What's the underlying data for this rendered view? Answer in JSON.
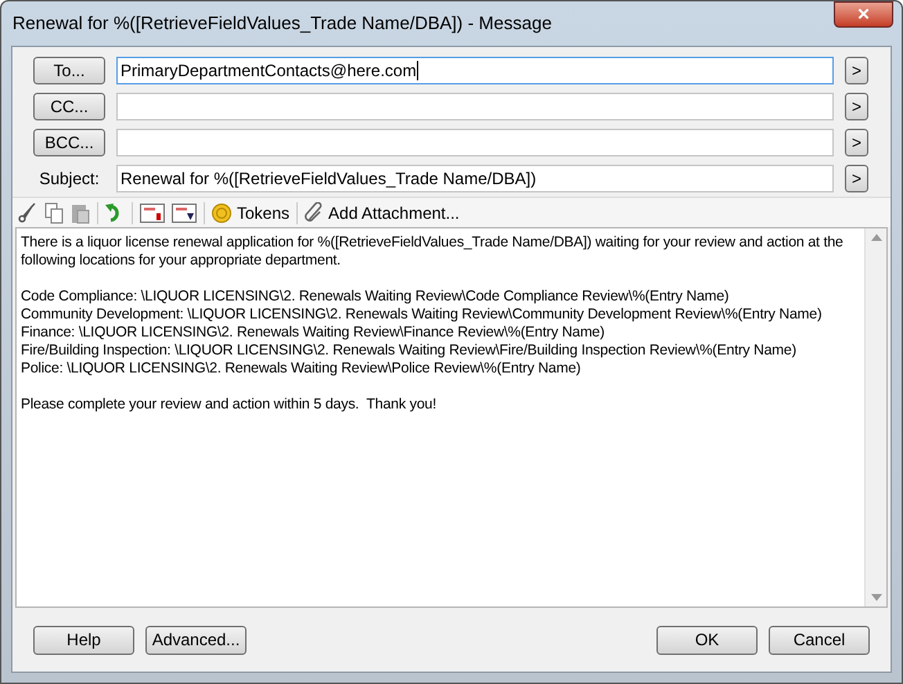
{
  "window": {
    "title": "Renewal for %([RetrieveFieldValues_Trade Name/DBA]) - Message",
    "close": "×"
  },
  "recipients": [
    {
      "kind": "button",
      "label": "To...",
      "value": "PrimaryDepartmentContacts@here.com",
      "focused": true,
      "more": ">"
    },
    {
      "kind": "button",
      "label": "CC...",
      "focused": false,
      "more": ">"
    },
    {
      "kind": "button",
      "label": "BCC...",
      "focused": false,
      "more": ">"
    },
    {
      "kind": "label",
      "label": "Subject:",
      "value": "Renewal for %([RetrieveFieldValues_Trade Name/DBA])",
      "focused": false,
      "more": ">"
    }
  ],
  "toolbar": {
    "tokens": "Tokens",
    "attachment": "Add Attachment..."
  },
  "body": {
    "paragraphs": [
      [
        "There is a liquor license renewal application for %([RetrieveFieldValues_Trade Name/DBA]) waiting for your review and action at the following locations for your appropriate department."
      ],
      [
        "Code Compliance: \\LIQUOR LICENSING\\2. Renewals Waiting Review\\Code Compliance Review\\%(Entry Name)",
        "Community Development: \\LIQUOR LICENSING\\2. Renewals Waiting Review\\Community Development Review\\%(Entry Name)",
        "Finance: \\LIQUOR LICENSING\\2. Renewals Waiting Review\\Finance Review\\%(Entry Name)",
        "Fire/Building Inspection: \\LIQUOR LICENSING\\2. Renewals Waiting Review\\Fire/Building Inspection Review\\%(Entry Name)",
        "Police: \\LIQUOR LICENSING\\2. Renewals Waiting Review\\Police Review\\%(Entry Name)"
      ],
      [
        "Please complete your review and action within 5 days.  Thank you!"
      ]
    ]
  },
  "buttons_left": [
    "Help",
    "Advanced..."
  ],
  "buttons_right": [
    "OK",
    "Cancel"
  ]
}
